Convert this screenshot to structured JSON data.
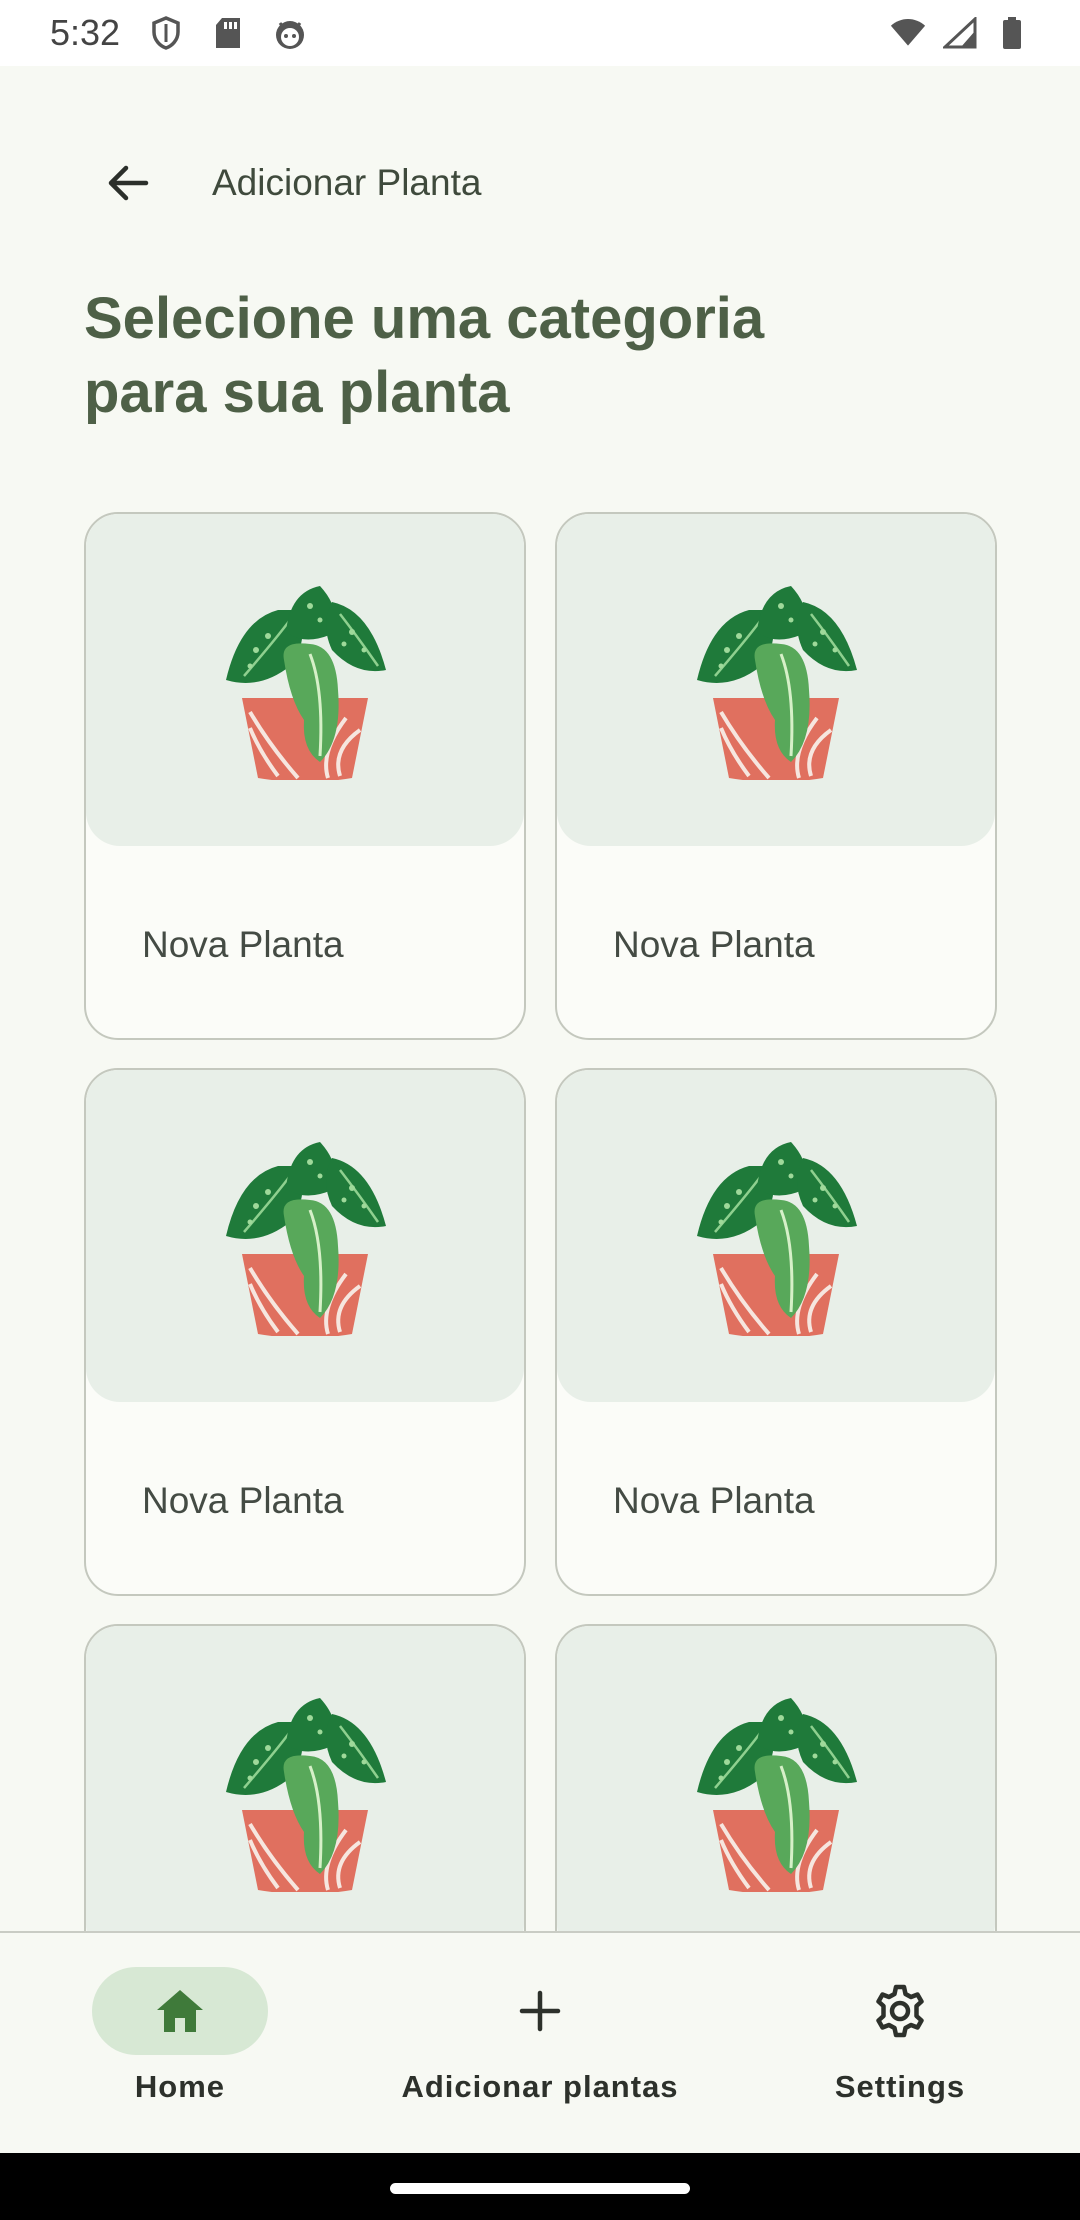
{
  "status_bar": {
    "time": "5:32",
    "left_icons": [
      "shield-icon",
      "sd-card-icon",
      "android-face-icon"
    ],
    "right_icons": [
      "wifi-icon",
      "cell-signal-icon",
      "battery-icon"
    ]
  },
  "top_bar": {
    "title": "Adicionar Planta",
    "back_icon": "arrow-back-icon"
  },
  "heading": "Selecione uma categoria\npara sua planta",
  "cards": [
    {
      "label": "Nova Planta",
      "image": "potted-plant-illustration"
    },
    {
      "label": "Nova Planta",
      "image": "potted-plant-illustration"
    },
    {
      "label": "Nova Planta",
      "image": "potted-plant-illustration"
    },
    {
      "label": "Nova Planta",
      "image": "potted-plant-illustration"
    },
    {
      "label": "",
      "image": "potted-plant-illustration"
    },
    {
      "label": "",
      "image": "potted-plant-illustration"
    }
  ],
  "bottom_nav": {
    "items": [
      {
        "label": "Home",
        "icon": "home-icon",
        "active": true
      },
      {
        "label": "Adicionar plantas",
        "icon": "plus-icon",
        "active": false
      },
      {
        "label": "Settings",
        "icon": "gear-icon",
        "active": false
      }
    ]
  },
  "colors": {
    "background": "#f7f9f3",
    "heading": "#4e6047",
    "card_media": "#e8efe8",
    "nav_active_indicator": "#d7e8d4",
    "home_icon": "#3f7a3a",
    "pot": "#e0705f",
    "leaf_dark": "#1f7a3a",
    "leaf_light": "#58a85a"
  }
}
